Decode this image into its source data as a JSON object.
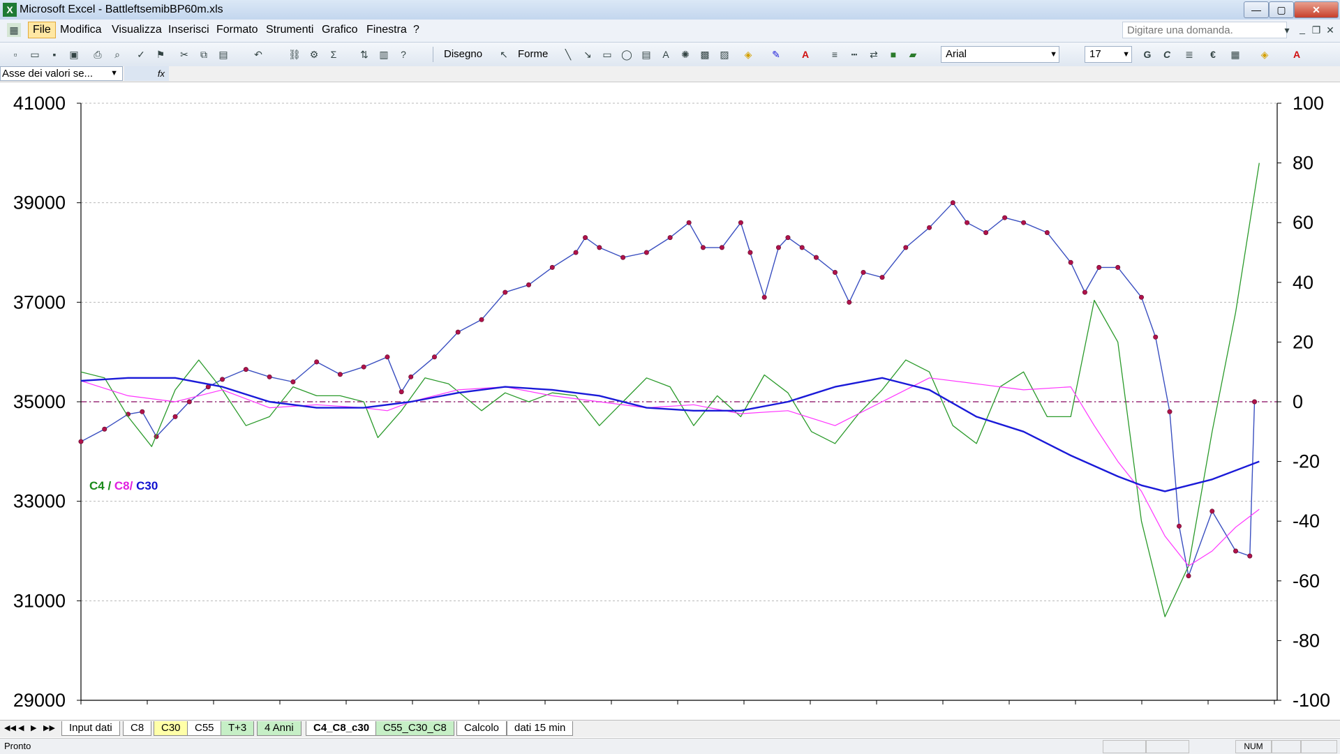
{
  "window": {
    "title": "Microsoft Excel - BattleftsemibBP60m.xls",
    "app_icon": "X",
    "minimize_icon": "—",
    "maximize_icon": "▢",
    "close_icon": "✕"
  },
  "menu": {
    "items": [
      "File",
      "Modifica",
      "Visualizza",
      "Inserisci",
      "Formato",
      "Strumenti",
      "Grafico",
      "Finestra",
      "?"
    ],
    "help_placeholder": "Digitare una domanda.",
    "doc_min": "_",
    "doc_restore": "❐",
    "doc_close": "✕"
  },
  "toolbar": {
    "disegno_label": "Disegno",
    "forme_label": "Forme",
    "font_name": "Arial",
    "font_size": "17",
    "bold_label": "G",
    "italic_label": "C",
    "euro_label": "€",
    "sigma_label": "Σ"
  },
  "formula_bar": {
    "name_box": "Asse dei valori se...",
    "fx": "fx"
  },
  "sheets": {
    "nav": [
      "◀◀",
      "◀",
      "▶",
      "▶▶"
    ],
    "tabs": [
      {
        "label": "Input dati",
        "color": "white"
      },
      {
        "label": "C8",
        "color": "white"
      },
      {
        "label": "C30",
        "color": "yellow"
      },
      {
        "label": "C55",
        "color": "white"
      },
      {
        "label": "T+3",
        "color": "green"
      },
      {
        "label": "4 Anni",
        "color": "green"
      },
      {
        "label": "C4_C8_c30",
        "color": "active"
      },
      {
        "label": "C55_C30_C8",
        "color": "green"
      },
      {
        "label": "Calcolo",
        "color": "white"
      },
      {
        "label": "dati 15 min",
        "color": "white"
      }
    ]
  },
  "status": {
    "text": "Pronto",
    "num": "NUM"
  },
  "chart_data": {
    "type": "line",
    "legend": {
      "placement": "left-middle",
      "parts": [
        {
          "text": "C4",
          "color": "#1a8a1a"
        },
        {
          "text": " / ",
          "color": "#1a8a1a"
        },
        {
          "text": "C8/",
          "color": "#e020e0"
        },
        {
          "text": " C30",
          "color": "#1010d0"
        }
      ]
    },
    "left_axis": {
      "min": 29000,
      "max": 41000,
      "ticks": [
        29000,
        31000,
        33000,
        35000,
        37000,
        39000,
        41000
      ]
    },
    "right_axis": {
      "min": -100,
      "max": 100,
      "ticks": [
        -100,
        -80,
        -60,
        -40,
        -20,
        0,
        20,
        40,
        60,
        80,
        100
      ]
    },
    "grid": true,
    "zero_line": {
      "axis": "right",
      "value": 0,
      "color": "#9b2e7a",
      "style": "dash-dot"
    },
    "x_count": 20,
    "colors": {
      "price": "#3a4fc0",
      "marker": "#b0124a",
      "c4": "#2a9a2a",
      "c8": "#ff33ff",
      "c30": "#1a1ad8"
    },
    "series": [
      {
        "name": "price",
        "axis": "left",
        "markers": true,
        "points": [
          [
            0,
            34200
          ],
          [
            0.5,
            34450
          ],
          [
            1,
            34750
          ],
          [
            1.3,
            34800
          ],
          [
            1.6,
            34300
          ],
          [
            2,
            34700
          ],
          [
            2.3,
            35000
          ],
          [
            2.7,
            35300
          ],
          [
            3,
            35450
          ],
          [
            3.5,
            35650
          ],
          [
            4,
            35500
          ],
          [
            4.5,
            35400
          ],
          [
            5,
            35800
          ],
          [
            5.5,
            35550
          ],
          [
            6,
            35700
          ],
          [
            6.5,
            35900
          ],
          [
            6.8,
            35200
          ],
          [
            7,
            35500
          ],
          [
            7.5,
            35900
          ],
          [
            8,
            36400
          ],
          [
            8.5,
            36650
          ],
          [
            9,
            37200
          ],
          [
            9.5,
            37350
          ],
          [
            10,
            37700
          ],
          [
            10.5,
            38000
          ],
          [
            10.7,
            38300
          ],
          [
            11,
            38100
          ],
          [
            11.5,
            37900
          ],
          [
            12,
            38000
          ],
          [
            12.5,
            38300
          ],
          [
            12.9,
            38600
          ],
          [
            13.2,
            38100
          ],
          [
            13.6,
            38100
          ],
          [
            14,
            38600
          ],
          [
            14.2,
            38000
          ],
          [
            14.5,
            37100
          ],
          [
            14.8,
            38100
          ],
          [
            15,
            38300
          ],
          [
            15.3,
            38100
          ],
          [
            15.6,
            37900
          ],
          [
            16,
            37600
          ],
          [
            16.3,
            37000
          ],
          [
            16.6,
            37600
          ],
          [
            17,
            37500
          ],
          [
            17.5,
            38100
          ],
          [
            18,
            38500
          ],
          [
            18.5,
            39000
          ],
          [
            18.8,
            38600
          ],
          [
            19.2,
            38400
          ],
          [
            19.6,
            38700
          ],
          [
            20,
            38600
          ],
          [
            20.5,
            38400
          ],
          [
            21,
            37800
          ],
          [
            21.3,
            37200
          ],
          [
            21.6,
            37700
          ],
          [
            22,
            37700
          ],
          [
            22.5,
            37100
          ],
          [
            22.8,
            36300
          ],
          [
            23.1,
            34800
          ],
          [
            23.3,
            32500
          ],
          [
            23.5,
            31500
          ],
          [
            24,
            32800
          ],
          [
            24.5,
            32000
          ],
          [
            24.8,
            31900
          ],
          [
            24.9,
            35000
          ]
        ]
      },
      {
        "name": "c4",
        "axis": "right",
        "points": [
          [
            0,
            10
          ],
          [
            0.5,
            8
          ],
          [
            1,
            -5
          ],
          [
            1.5,
            -15
          ],
          [
            2,
            4
          ],
          [
            2.5,
            14
          ],
          [
            3,
            4
          ],
          [
            3.5,
            -8
          ],
          [
            4,
            -5
          ],
          [
            4.5,
            5
          ],
          [
            5,
            2
          ],
          [
            5.5,
            2
          ],
          [
            6,
            0
          ],
          [
            6.3,
            -12
          ],
          [
            6.8,
            -3
          ],
          [
            7.3,
            8
          ],
          [
            7.8,
            6
          ],
          [
            8.5,
            -3
          ],
          [
            9,
            3
          ],
          [
            9.5,
            0
          ],
          [
            10,
            3
          ],
          [
            10.5,
            2
          ],
          [
            11,
            -8
          ],
          [
            11.5,
            0
          ],
          [
            12,
            8
          ],
          [
            12.5,
            5
          ],
          [
            13,
            -8
          ],
          [
            13.5,
            2
          ],
          [
            14,
            -5
          ],
          [
            14.5,
            9
          ],
          [
            15,
            3
          ],
          [
            15.5,
            -10
          ],
          [
            16,
            -14
          ],
          [
            16.5,
            -4
          ],
          [
            17,
            4
          ],
          [
            17.5,
            14
          ],
          [
            18,
            10
          ],
          [
            18.5,
            -8
          ],
          [
            19,
            -14
          ],
          [
            19.5,
            5
          ],
          [
            20,
            10
          ],
          [
            20.5,
            -5
          ],
          [
            21,
            -5
          ],
          [
            21.5,
            34
          ],
          [
            22,
            20
          ],
          [
            22.5,
            -40
          ],
          [
            23,
            -72
          ],
          [
            23.5,
            -55
          ],
          [
            24,
            -10
          ],
          [
            24.5,
            30
          ],
          [
            25,
            80
          ]
        ]
      },
      {
        "name": "c8",
        "axis": "right",
        "points": [
          [
            0,
            7
          ],
          [
            1,
            2
          ],
          [
            2,
            0
          ],
          [
            3,
            4
          ],
          [
            4,
            -2
          ],
          [
            5,
            -1
          ],
          [
            6,
            -2
          ],
          [
            6.5,
            -3
          ],
          [
            7,
            0
          ],
          [
            8,
            4
          ],
          [
            9,
            5
          ],
          [
            10,
            2
          ],
          [
            11,
            0
          ],
          [
            12,
            -2
          ],
          [
            13,
            -1
          ],
          [
            14,
            -4
          ],
          [
            15,
            -3
          ],
          [
            16,
            -8
          ],
          [
            17,
            0
          ],
          [
            18,
            8
          ],
          [
            19,
            6
          ],
          [
            20,
            4
          ],
          [
            21,
            5
          ],
          [
            21.5,
            -8
          ],
          [
            22,
            -20
          ],
          [
            22.5,
            -30
          ],
          [
            23,
            -45
          ],
          [
            23.5,
            -55
          ],
          [
            24,
            -50
          ],
          [
            24.5,
            -42
          ],
          [
            25,
            -36
          ]
        ]
      },
      {
        "name": "c30",
        "axis": "right",
        "points": [
          [
            0,
            7
          ],
          [
            1,
            8
          ],
          [
            2,
            8
          ],
          [
            3,
            5
          ],
          [
            4,
            0
          ],
          [
            5,
            -2
          ],
          [
            6,
            -2
          ],
          [
            7,
            0
          ],
          [
            8,
            3
          ],
          [
            9,
            5
          ],
          [
            10,
            4
          ],
          [
            11,
            2
          ],
          [
            12,
            -2
          ],
          [
            13,
            -3
          ],
          [
            14,
            -3
          ],
          [
            15,
            0
          ],
          [
            16,
            5
          ],
          [
            17,
            8
          ],
          [
            18,
            4
          ],
          [
            19,
            -5
          ],
          [
            20,
            -10
          ],
          [
            21,
            -18
          ],
          [
            22,
            -25
          ],
          [
            22.5,
            -28
          ],
          [
            23,
            -30
          ],
          [
            24,
            -26
          ],
          [
            25,
            -20
          ]
        ]
      }
    ]
  }
}
